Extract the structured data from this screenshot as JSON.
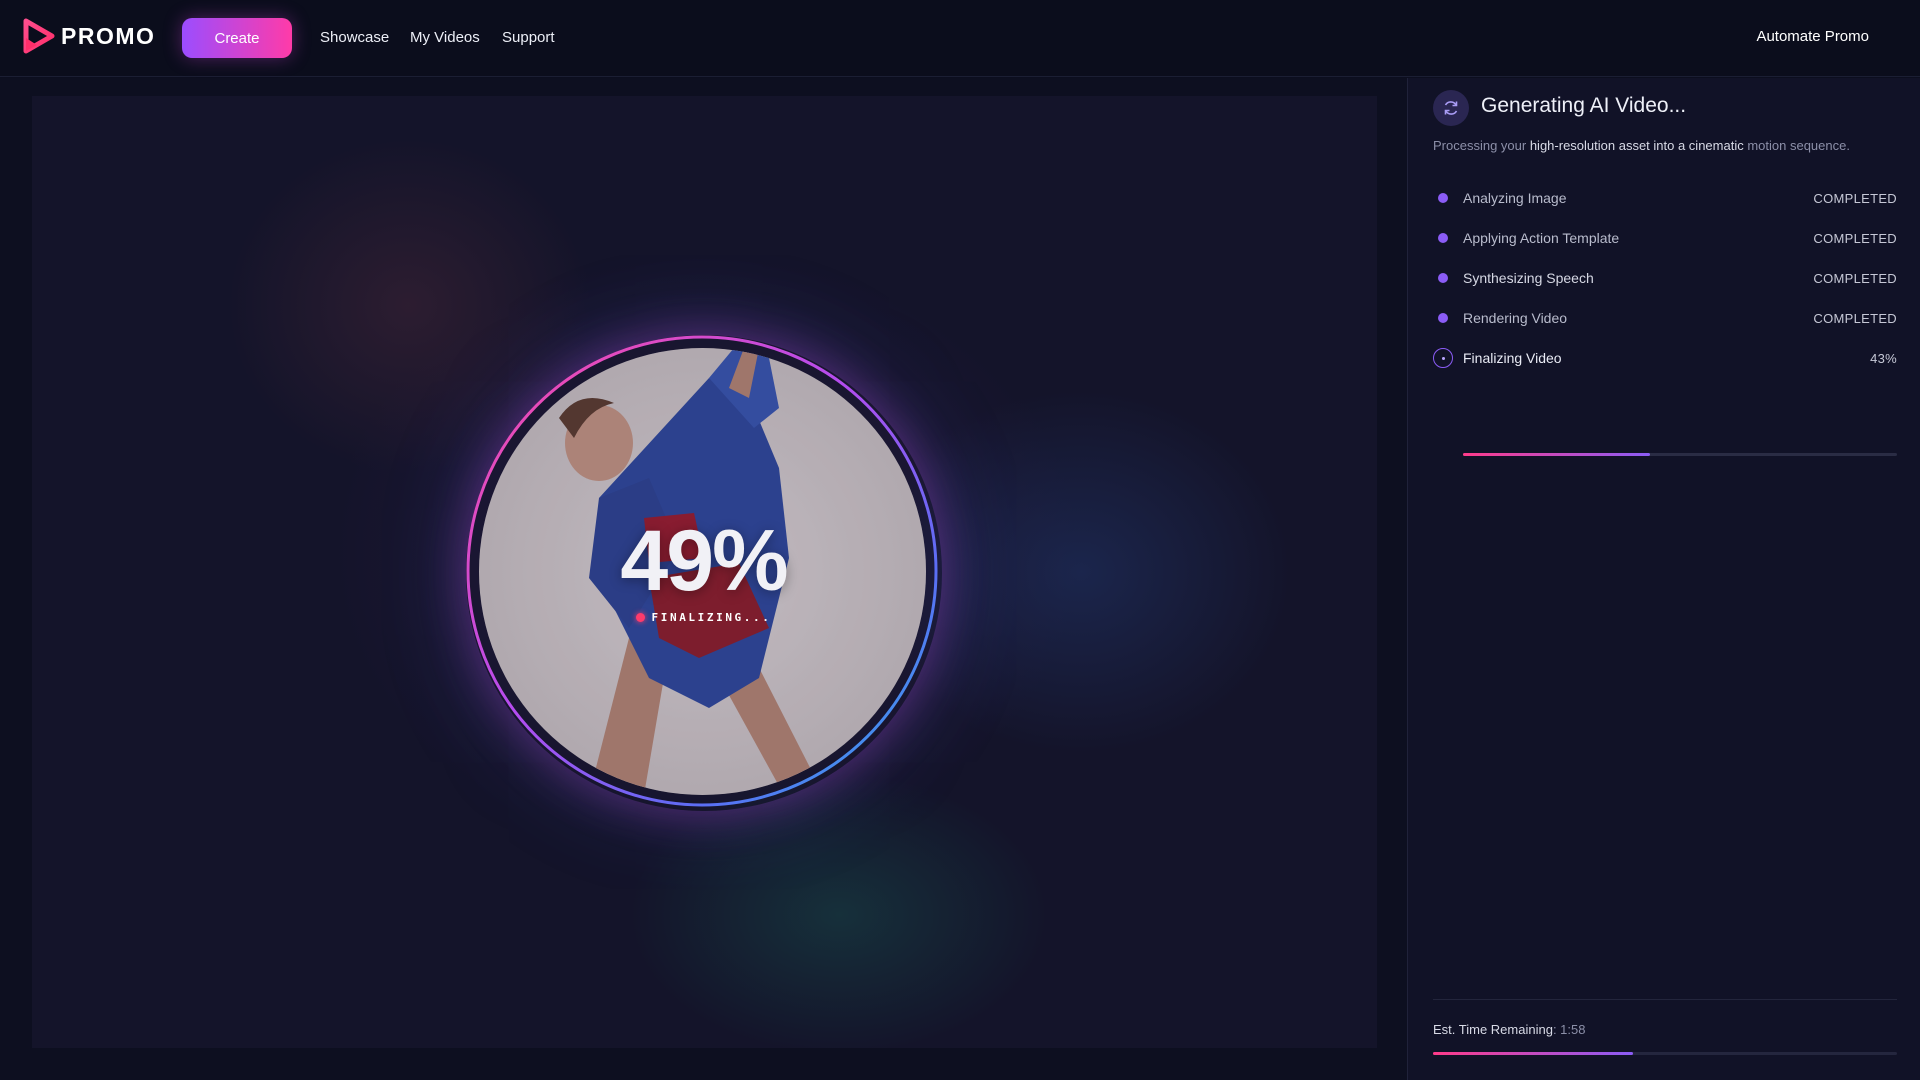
{
  "header": {
    "brand": "PROMO",
    "create_label": "Create",
    "nav": [
      "Showcase",
      "My Videos",
      "Support"
    ],
    "automate_label": "Automate Promo"
  },
  "stage": {
    "progress_label": "49%",
    "progress_value": 49,
    "status_text": "FINALIZING..."
  },
  "panel": {
    "title": "Generating AI Video...",
    "description_pre": "Processing your ",
    "description_hl": "high-resolution asset into a cinematic",
    "description_post": " motion sequence.",
    "steps": [
      {
        "label": "Analyzing Image",
        "status": "COMPLETED"
      },
      {
        "label": "Applying Action Template",
        "status": "COMPLETED"
      },
      {
        "label": "Synthesizing Speech",
        "status": "COMPLETED"
      },
      {
        "label": "Rendering Video",
        "status": "COMPLETED"
      },
      {
        "label": "Finalizing Video",
        "status": "43%"
      }
    ],
    "current_step_progress": 0.43,
    "eta_label": "Est. Time Remaining",
    "eta_value": ": 1:58",
    "overall_progress": 0.43
  },
  "colors": {
    "accent_purple": "#8b5cf6",
    "accent_pink": "#ff3b8a",
    "status_dot": "#ff3b6b"
  },
  "icons": {
    "logo": "play-triangle-logo-icon",
    "panel": "refresh-icon"
  }
}
